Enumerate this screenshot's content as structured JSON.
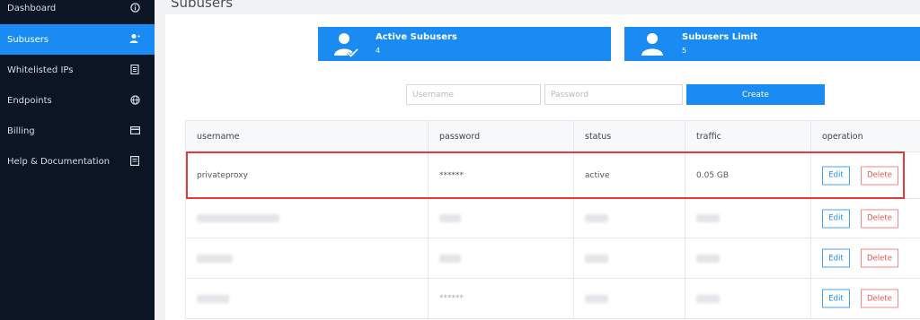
{
  "sidebar": {
    "items": [
      {
        "label": "Dashboard",
        "icon": "info-icon",
        "active": false
      },
      {
        "label": "Subusers",
        "icon": "user-plus-icon",
        "active": true
      },
      {
        "label": "Whitelisted IPs",
        "icon": "list-icon",
        "active": false
      },
      {
        "label": "Endpoints",
        "icon": "globe-icon",
        "active": false
      },
      {
        "label": "Billing",
        "icon": "card-icon",
        "active": false
      },
      {
        "label": "Help & Documentation",
        "icon": "document-icon",
        "active": false
      }
    ]
  },
  "page": {
    "title": "Subusers"
  },
  "cards": {
    "active": {
      "title": "Active Subusers",
      "value": "4",
      "icon": "user-check-icon"
    },
    "limit": {
      "title": "Subusers Limit",
      "value": "5",
      "icon": "user-icon"
    }
  },
  "form": {
    "username_placeholder": "Username",
    "password_placeholder": "Password",
    "create_label": "Create"
  },
  "table": {
    "headers": [
      "username",
      "password",
      "status",
      "traffic",
      "operation"
    ],
    "rows": [
      {
        "username": "privateproxy",
        "password": "******",
        "status": "active",
        "traffic": "0.05 GB",
        "edit": "Edit",
        "delete": "Delete"
      },
      {
        "username": "",
        "password": "",
        "status": "",
        "traffic": "",
        "edit": "Edit",
        "delete": "Delete"
      },
      {
        "username": "",
        "password": "",
        "status": "",
        "traffic": "",
        "edit": "Edit",
        "delete": "Delete"
      },
      {
        "username": "",
        "password": "******",
        "status": "",
        "traffic": "",
        "edit": "Edit",
        "delete": "Delete"
      }
    ]
  },
  "colors": {
    "accent": "#1a8bf2",
    "sidebar_bg": "#0c1524",
    "danger": "#e65454",
    "highlight": "#e23b3b"
  }
}
